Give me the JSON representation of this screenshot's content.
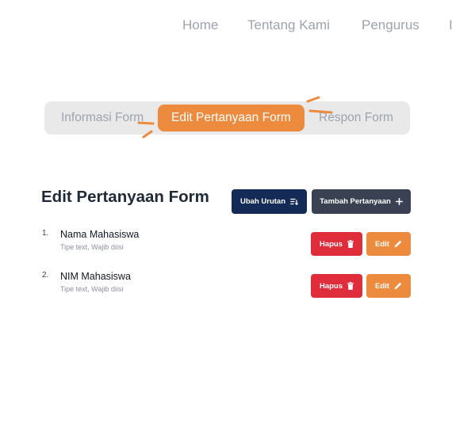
{
  "nav": {
    "items": [
      "Home",
      "Tentang Kami",
      "Pengurus",
      "I"
    ]
  },
  "tabs": [
    {
      "label": "Informasi Form",
      "active": false
    },
    {
      "label": "Edit Pertanyaan Form",
      "active": true
    },
    {
      "label": "Respon Form",
      "active": false
    }
  ],
  "main": {
    "title": "Edit Pertanyaan Form",
    "reorder_label": "Ubah Urutan",
    "add_label": "Tambah Pertanyaan",
    "questions": [
      {
        "number": "1.",
        "title": "Nama Mahasiswa",
        "meta": "Tipe text, Wajib diisi",
        "delete_label": "Hapus",
        "edit_label": "Edit"
      },
      {
        "number": "2.",
        "title": "NIM Mahasiswa",
        "meta": "Tipe text, Wajib diisi",
        "delete_label": "Hapus",
        "edit_label": "Edit"
      }
    ]
  },
  "colors": {
    "accent": "#ec8a3e",
    "navy": "#152b57",
    "slate": "#394152",
    "danger": "#e02d3b",
    "muted": "#9ca3af",
    "tab_track": "#e9e9ea"
  },
  "icons": {
    "reorder": "sort-icon",
    "add": "plus-icon",
    "delete": "trash-icon",
    "edit": "pencil-icon"
  }
}
